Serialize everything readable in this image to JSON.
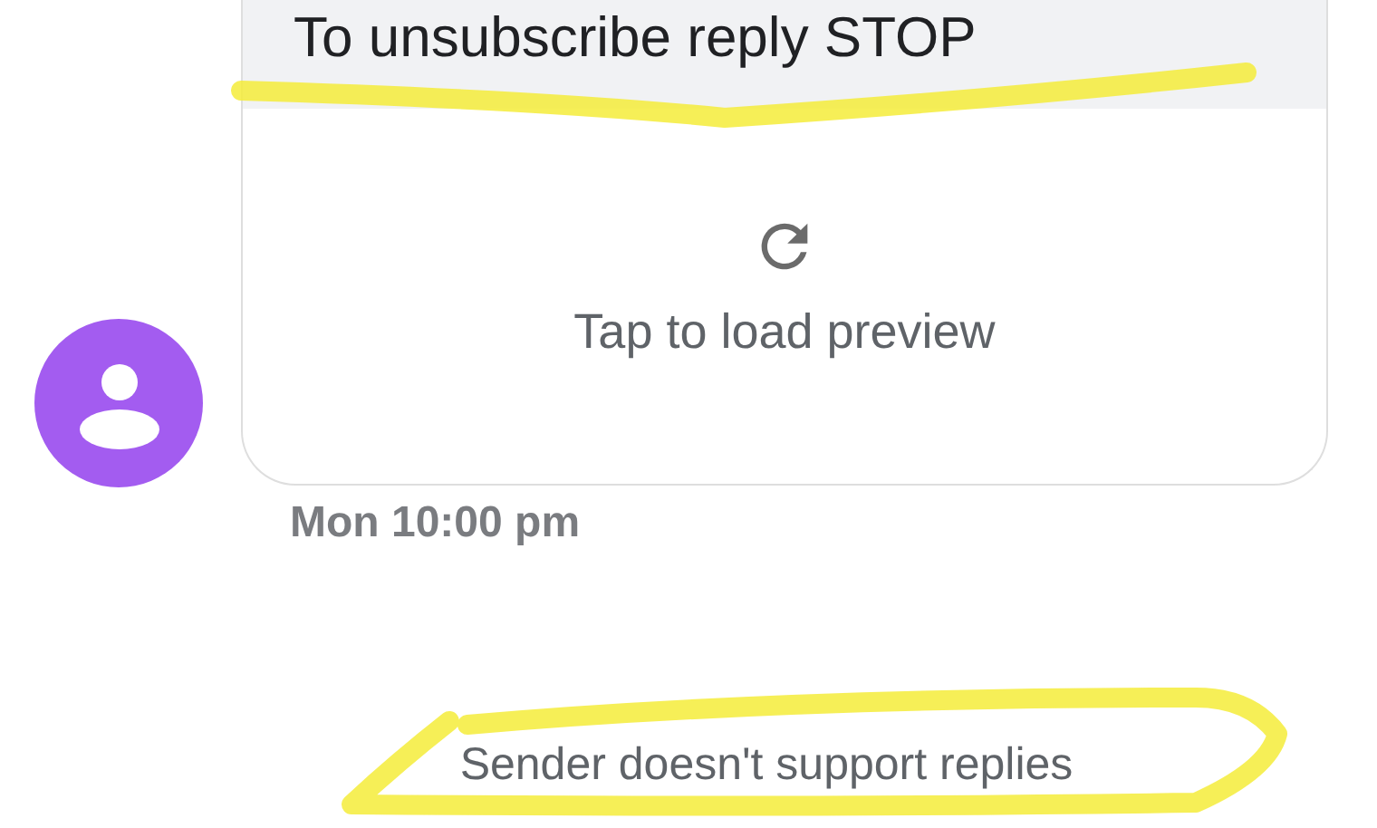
{
  "message": {
    "text": "To unsubscribe reply STOP",
    "preview_label": "Tap to load preview",
    "time": "Mon 10:00 pm"
  },
  "footer_notice": "Sender doesn't support replies"
}
